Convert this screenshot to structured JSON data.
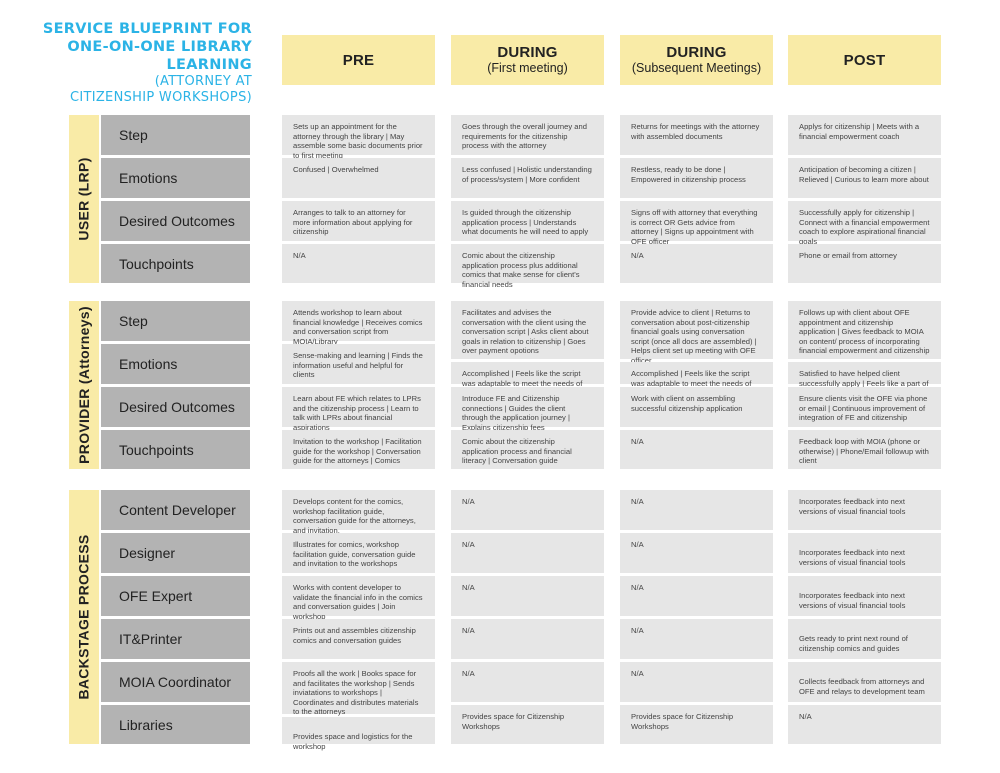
{
  "title": {
    "line1": "SERVICE BLUEPRINT FOR",
    "line2": "ONE-ON-ONE LIBRARY",
    "line3": "LEARNING",
    "sub1": "(ATTORNEY AT",
    "sub2": "CITIZENSHIP WORKSHOPS)"
  },
  "colors": {
    "title": "#2bb3e6",
    "header_fill": "#f9eba7",
    "row_label_fill": "#b3b3b3",
    "cell_fill": "#e6e6e6"
  },
  "phases": [
    {
      "name": "PRE",
      "sub": ""
    },
    {
      "name": "DURING",
      "sub": "(First meeting)"
    },
    {
      "name": "DURING",
      "sub": "(Subsequent Meetings)"
    },
    {
      "name": "POST",
      "sub": ""
    }
  ],
  "lanes": [
    {
      "label": "USER (LRP)",
      "rows": [
        {
          "label": "Step",
          "cells": [
            "Sets up an appointment for the attorney through the library | May assemble some basic documents prior to first meeting",
            "Goes through the overall journey and requirements for the citizenship process with the attorney",
            "Returns for meetings with the attorney with assembled documents",
            "Applys for citizenship | Meets with a financial empowerment coach"
          ]
        },
        {
          "label": "Emotions",
          "cells": [
            "Confused | Overwhelmed",
            "Less confused | Holistic understanding of process/system | More confident",
            "Restless, ready to be done | Empowered in citizenship process",
            "Anticipation of becoming a citizen | Relieved | Curious to learn more about"
          ]
        },
        {
          "label": "Desired Outcomes",
          "cells": [
            "Arranges to talk to an attorney for more information about applying for citizenship",
            "Is guided through the citizenship application process | Understands what documents he will need to apply",
            "Signs off with attorney that everything is correct OR Gets advice from attorney | Signs up appointment with OFE officer",
            "Successfully apply for citizenship | Connect with a financial empowerment coach to explore aspirational financial goals"
          ]
        },
        {
          "label": "Touchpoints",
          "cells": [
            "N/A",
            "Comic about the citizenship application process plus additional comics that make sense for client's financial needs",
            "N/A",
            "Phone or email from attorney"
          ]
        }
      ]
    },
    {
      "label": "PROVIDER (Attorneys)",
      "rows": [
        {
          "label": "Step",
          "cells": [
            "Attends workshop to learn about financial knowledge | Receives comics and conversation script from MOIA/Library",
            "Facilitates and advises the conversation with the client using the conversation script | Asks client about goals in relation to citizenship | Goes over payment opotions",
            "Provide advice to client | Returns to conversation about post-citizenship financial goals using conversation script (once all docs are assembled) | Helps client set up meeting with OFE officer.",
            "Follows up with client about OFE appointment and citizenship application | Gives feedback to MOIA on content/ process of incorporating financial empowerment and citizenship"
          ]
        },
        {
          "label": "Emotions",
          "cells": [
            "Sense-making and learning | Finds the information useful and helpful for clients",
            "Accomplished | Feels like the script was adaptable to meet the needs of the client",
            "Accomplished | Feels like the script was adaptable to meet the needs of the client",
            "Satisfied to have helped client successfully apply | Feels like a part of the process"
          ]
        },
        {
          "label": "Desired Outcomes",
          "cells": [
            "Learn about FE which relates to LPRs and the citizenship process | Learn to talk with LPRs about financial aspirations",
            "Introduce FE and Citizenship connections | Guides the client through the application journey | Explains citizenship fees",
            "Work with client on assembling successful citizenship application",
            "Ensure clients visit the OFE via phone or email | Continuous improvement of integration of FE and citizenship"
          ]
        },
        {
          "label": "Touchpoints",
          "cells": [
            "Invitation to the workshop | Facilitation guide for the workshop | Conversation guide for the attorneys | Comics",
            "Comic about the citizenship application process and financial literacy | Conversation guide",
            "N/A",
            "Feedback loop with MOIA (phone or otherwise) | Phone/Email followup with client"
          ]
        }
      ]
    },
    {
      "label": "BACKSTAGE PROCESS",
      "rows": [
        {
          "label": "Content Developer",
          "cells": [
            "Develops content for the comics, workshop facilitation guide, conversation guide for the attorneys, and invitation.",
            "N/A",
            "N/A",
            "Incorporates feedback into next versions of visual financial tools"
          ]
        },
        {
          "label": "Designer",
          "cells": [
            "Illustrates for comics, workshop facilitation guide, conversation guide and invitation to the workshops",
            "N/A",
            "N/A",
            "Incorporates feedback into next versions of visual financial tools"
          ]
        },
        {
          "label": "OFE Expert",
          "cells": [
            "Works with content developer to validate the financial info in the comics and conversation guides | Join workshop",
            "N/A",
            "N/A",
            "Incorporates feedback into next versions of visual financial tools"
          ]
        },
        {
          "label": "IT&Printer",
          "cells": [
            "Prints out and assembles citizenship comics and conversation guides",
            "N/A",
            "N/A",
            "Gets ready to print next round of citizenship comics and guides"
          ]
        },
        {
          "label": "MOIA Coordinator",
          "cells": [
            "Proofs all the work | Books space for and facilitates the workshop | Sends inviatations to workshops | Coordinates and distributes materials to the attorneys",
            "N/A",
            "N/A",
            "Collects feedback from attorneys and OFE and relays to development team"
          ]
        },
        {
          "label": "Libraries",
          "cells": [
            "Provides space and logistics for the workshop",
            "Provides space for Citizenship Workshops",
            "Provides space for Citizenship Workshops",
            "N/A"
          ]
        }
      ]
    }
  ]
}
